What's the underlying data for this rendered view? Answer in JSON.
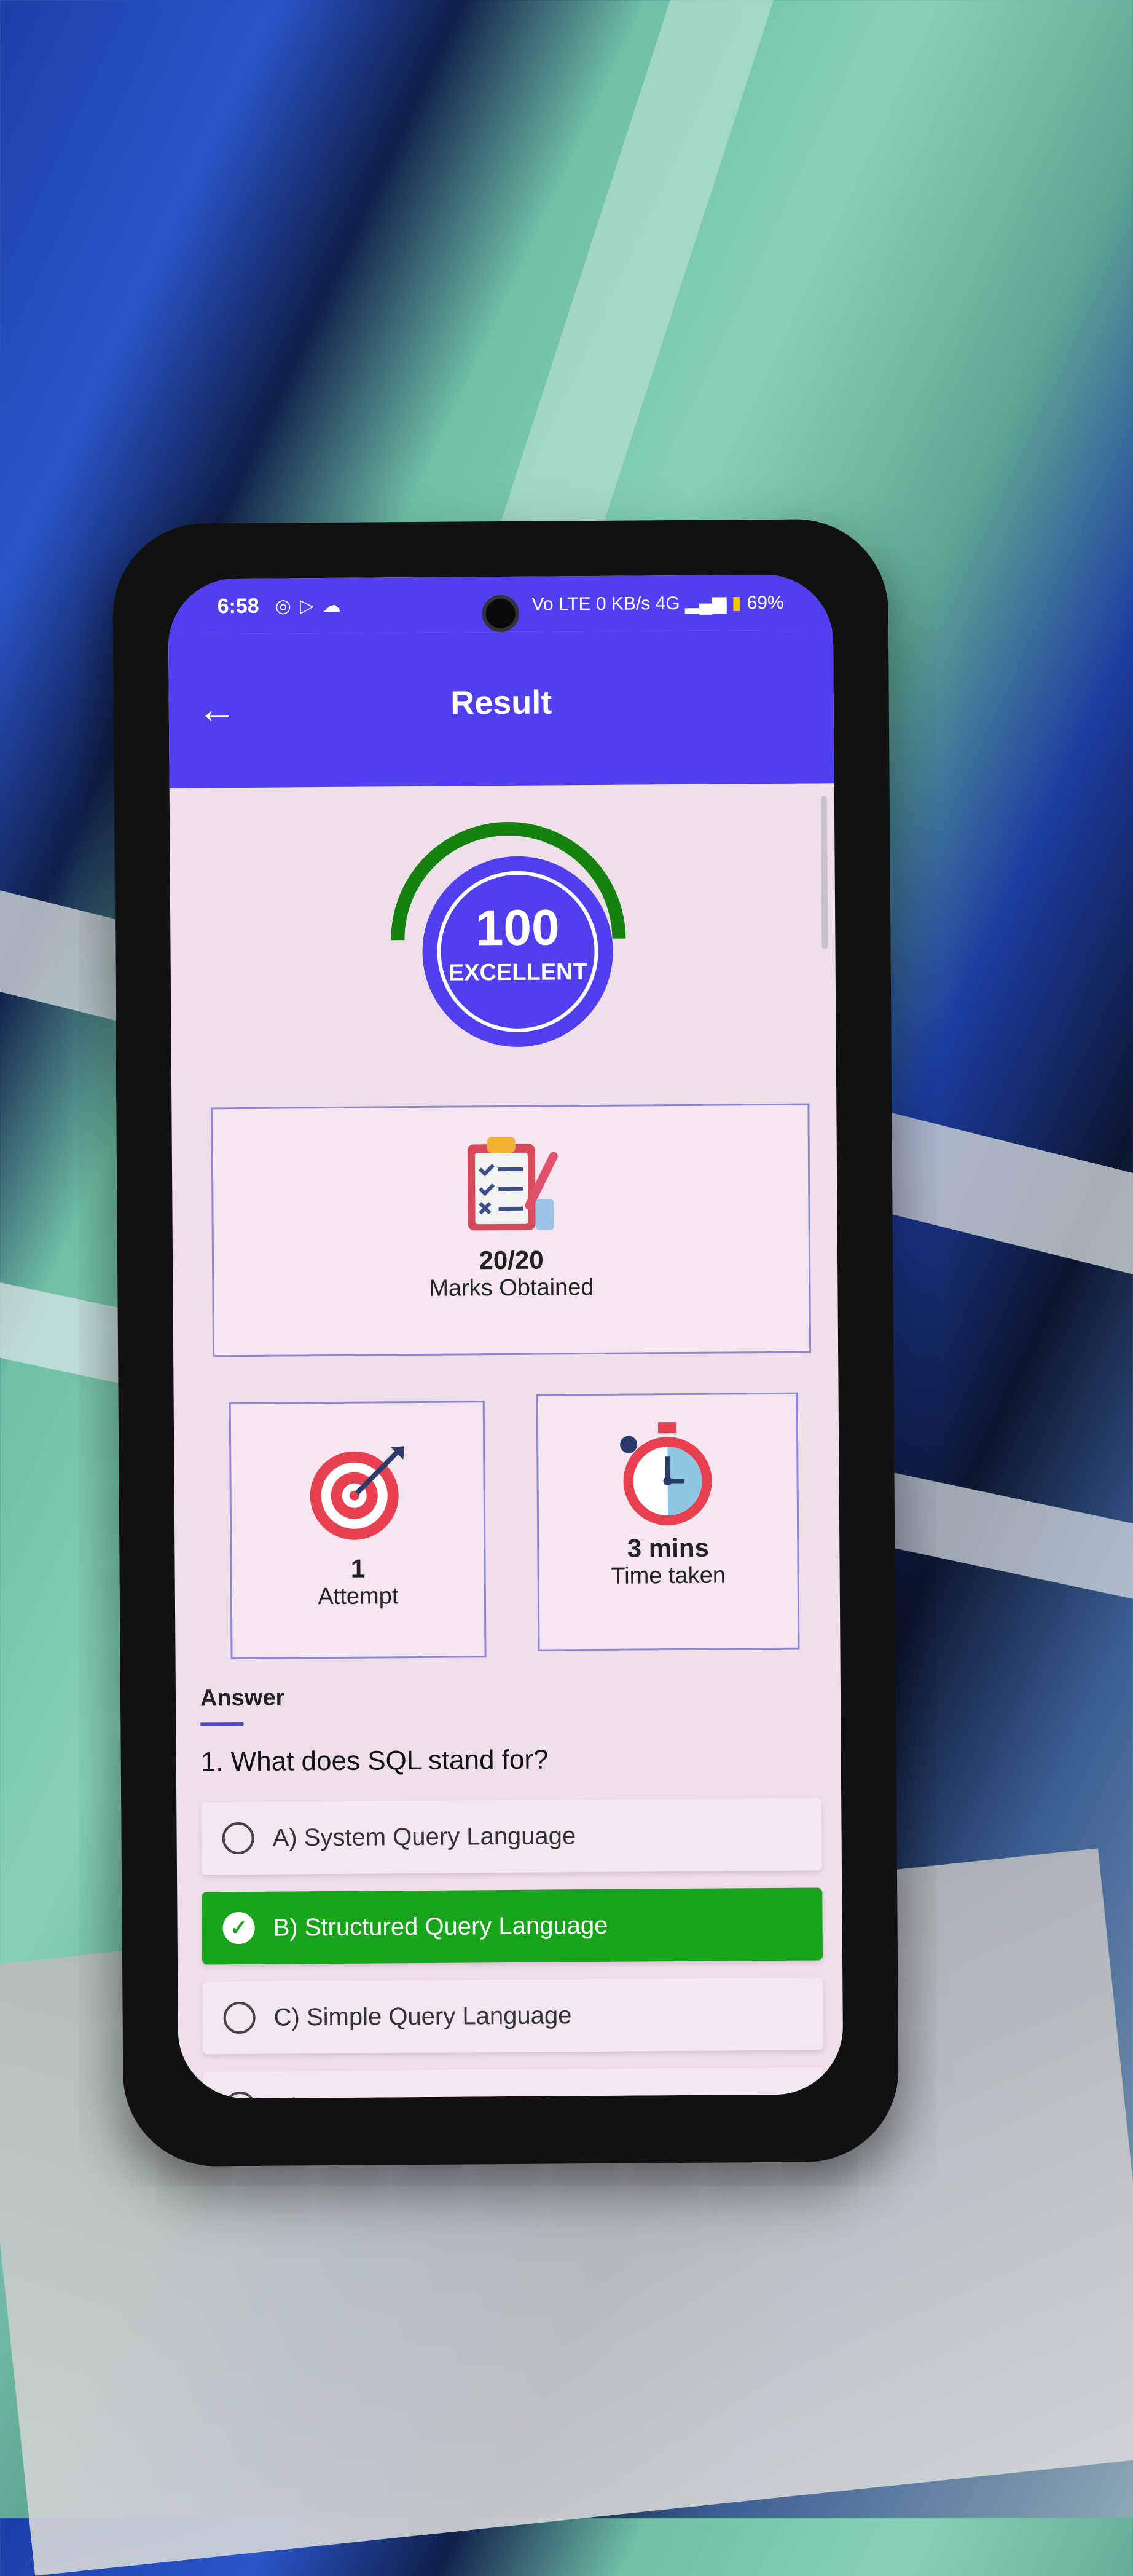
{
  "status_bar": {
    "time": "6:58",
    "left_icons": [
      "whatsapp-icon",
      "play-icon",
      "cloud-icon"
    ],
    "right_text": "Vo LTE 0 KB/s 4G",
    "battery": "69%"
  },
  "app_bar": {
    "title": "Result"
  },
  "score": {
    "value": "100",
    "label": "EXCELLENT",
    "gauge_color": "#13820f"
  },
  "marks": {
    "value": "20/20",
    "label": "Marks Obtained"
  },
  "attempt": {
    "value": "1",
    "label": "Attempt"
  },
  "time_taken": {
    "value": "3 mins",
    "label": "Time taken"
  },
  "answer_section": {
    "title": "Answer",
    "question": "1. What does SQL stand for?",
    "options": [
      {
        "text": "A) System Query Language",
        "correct": false
      },
      {
        "text": "B) Structured Query Language",
        "correct": true
      },
      {
        "text": "C) Simple Query Language",
        "correct": false
      },
      {
        "text": "D) Server Query Language",
        "correct": false
      }
    ]
  },
  "colors": {
    "primary": "#4f3ff0",
    "correct": "#18a51c",
    "background": "#efdfe9"
  }
}
